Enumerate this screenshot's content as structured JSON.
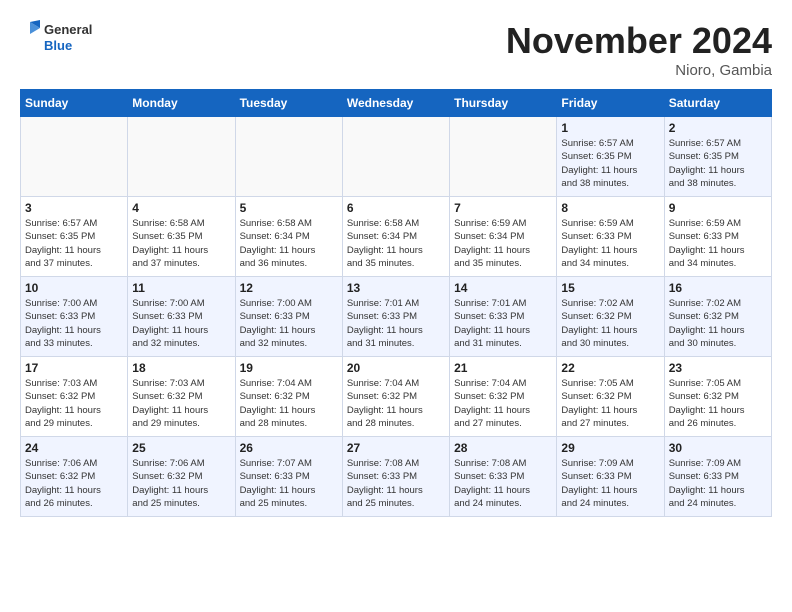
{
  "header": {
    "logo_general": "General",
    "logo_blue": "Blue",
    "month_title": "November 2024",
    "location": "Nioro, Gambia"
  },
  "days_of_week": [
    "Sunday",
    "Monday",
    "Tuesday",
    "Wednesday",
    "Thursday",
    "Friday",
    "Saturday"
  ],
  "weeks": [
    [
      {
        "day": "",
        "info": ""
      },
      {
        "day": "",
        "info": ""
      },
      {
        "day": "",
        "info": ""
      },
      {
        "day": "",
        "info": ""
      },
      {
        "day": "",
        "info": ""
      },
      {
        "day": "1",
        "info": "Sunrise: 6:57 AM\nSunset: 6:35 PM\nDaylight: 11 hours\nand 38 minutes."
      },
      {
        "day": "2",
        "info": "Sunrise: 6:57 AM\nSunset: 6:35 PM\nDaylight: 11 hours\nand 38 minutes."
      }
    ],
    [
      {
        "day": "3",
        "info": "Sunrise: 6:57 AM\nSunset: 6:35 PM\nDaylight: 11 hours\nand 37 minutes."
      },
      {
        "day": "4",
        "info": "Sunrise: 6:58 AM\nSunset: 6:35 PM\nDaylight: 11 hours\nand 37 minutes."
      },
      {
        "day": "5",
        "info": "Sunrise: 6:58 AM\nSunset: 6:34 PM\nDaylight: 11 hours\nand 36 minutes."
      },
      {
        "day": "6",
        "info": "Sunrise: 6:58 AM\nSunset: 6:34 PM\nDaylight: 11 hours\nand 35 minutes."
      },
      {
        "day": "7",
        "info": "Sunrise: 6:59 AM\nSunset: 6:34 PM\nDaylight: 11 hours\nand 35 minutes."
      },
      {
        "day": "8",
        "info": "Sunrise: 6:59 AM\nSunset: 6:33 PM\nDaylight: 11 hours\nand 34 minutes."
      },
      {
        "day": "9",
        "info": "Sunrise: 6:59 AM\nSunset: 6:33 PM\nDaylight: 11 hours\nand 34 minutes."
      }
    ],
    [
      {
        "day": "10",
        "info": "Sunrise: 7:00 AM\nSunset: 6:33 PM\nDaylight: 11 hours\nand 33 minutes."
      },
      {
        "day": "11",
        "info": "Sunrise: 7:00 AM\nSunset: 6:33 PM\nDaylight: 11 hours\nand 32 minutes."
      },
      {
        "day": "12",
        "info": "Sunrise: 7:00 AM\nSunset: 6:33 PM\nDaylight: 11 hours\nand 32 minutes."
      },
      {
        "day": "13",
        "info": "Sunrise: 7:01 AM\nSunset: 6:33 PM\nDaylight: 11 hours\nand 31 minutes."
      },
      {
        "day": "14",
        "info": "Sunrise: 7:01 AM\nSunset: 6:33 PM\nDaylight: 11 hours\nand 31 minutes."
      },
      {
        "day": "15",
        "info": "Sunrise: 7:02 AM\nSunset: 6:32 PM\nDaylight: 11 hours\nand 30 minutes."
      },
      {
        "day": "16",
        "info": "Sunrise: 7:02 AM\nSunset: 6:32 PM\nDaylight: 11 hours\nand 30 minutes."
      }
    ],
    [
      {
        "day": "17",
        "info": "Sunrise: 7:03 AM\nSunset: 6:32 PM\nDaylight: 11 hours\nand 29 minutes."
      },
      {
        "day": "18",
        "info": "Sunrise: 7:03 AM\nSunset: 6:32 PM\nDaylight: 11 hours\nand 29 minutes."
      },
      {
        "day": "19",
        "info": "Sunrise: 7:04 AM\nSunset: 6:32 PM\nDaylight: 11 hours\nand 28 minutes."
      },
      {
        "day": "20",
        "info": "Sunrise: 7:04 AM\nSunset: 6:32 PM\nDaylight: 11 hours\nand 28 minutes."
      },
      {
        "day": "21",
        "info": "Sunrise: 7:04 AM\nSunset: 6:32 PM\nDaylight: 11 hours\nand 27 minutes."
      },
      {
        "day": "22",
        "info": "Sunrise: 7:05 AM\nSunset: 6:32 PM\nDaylight: 11 hours\nand 27 minutes."
      },
      {
        "day": "23",
        "info": "Sunrise: 7:05 AM\nSunset: 6:32 PM\nDaylight: 11 hours\nand 26 minutes."
      }
    ],
    [
      {
        "day": "24",
        "info": "Sunrise: 7:06 AM\nSunset: 6:32 PM\nDaylight: 11 hours\nand 26 minutes."
      },
      {
        "day": "25",
        "info": "Sunrise: 7:06 AM\nSunset: 6:32 PM\nDaylight: 11 hours\nand 25 minutes."
      },
      {
        "day": "26",
        "info": "Sunrise: 7:07 AM\nSunset: 6:33 PM\nDaylight: 11 hours\nand 25 minutes."
      },
      {
        "day": "27",
        "info": "Sunrise: 7:08 AM\nSunset: 6:33 PM\nDaylight: 11 hours\nand 25 minutes."
      },
      {
        "day": "28",
        "info": "Sunrise: 7:08 AM\nSunset: 6:33 PM\nDaylight: 11 hours\nand 24 minutes."
      },
      {
        "day": "29",
        "info": "Sunrise: 7:09 AM\nSunset: 6:33 PM\nDaylight: 11 hours\nand 24 minutes."
      },
      {
        "day": "30",
        "info": "Sunrise: 7:09 AM\nSunset: 6:33 PM\nDaylight: 11 hours\nand 24 minutes."
      }
    ]
  ]
}
